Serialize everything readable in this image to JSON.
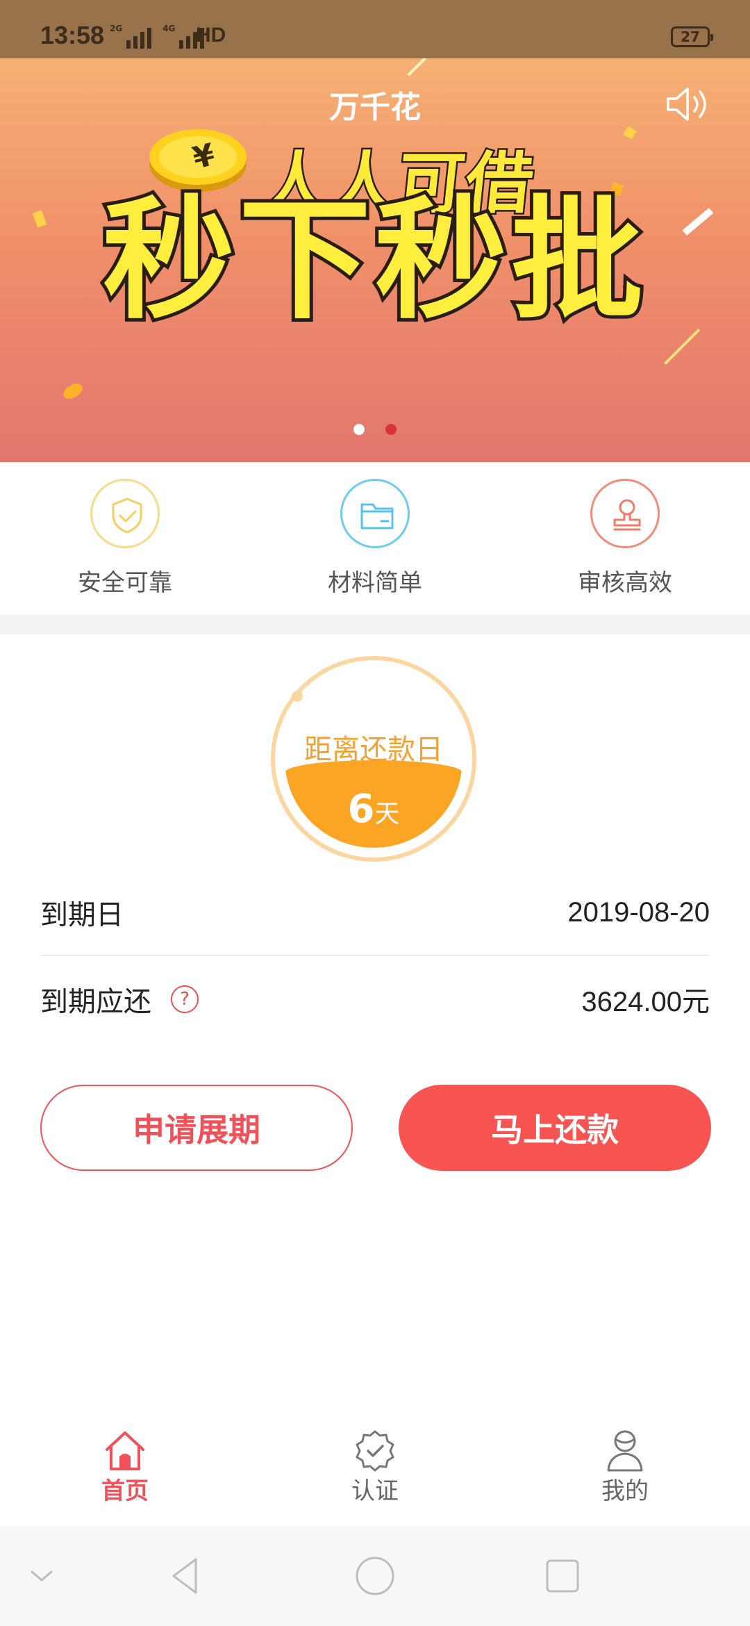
{
  "status_bar": {
    "time": "13:58",
    "network_1": "2G",
    "network_2": "4G",
    "hd_label": "HD",
    "battery": "27"
  },
  "banner": {
    "app_name": "万千花",
    "headline_1": "人人可借",
    "headline_2": "秒下秒批",
    "coin_symbol": "¥",
    "sound_icon": "speaker-icon",
    "page_count": 2,
    "active_page": 2
  },
  "features": [
    {
      "label": "安全可靠",
      "icon": "shield-check-icon",
      "color": "#f6dc86"
    },
    {
      "label": "材料简单",
      "icon": "folder-icon",
      "color": "#6ecbf0"
    },
    {
      "label": "审核高效",
      "icon": "stamp-icon",
      "color": "#f08c7a"
    }
  ],
  "countdown": {
    "label": "距离还款日",
    "days": "6",
    "unit": "天"
  },
  "loan": {
    "due_date_label": "到期日",
    "due_date": "2019-08-20",
    "due_amount_label": "到期应还",
    "due_amount": "3624.00元",
    "help_symbol": "?"
  },
  "actions": {
    "extend_label": "申请展期",
    "repay_label": "马上还款"
  },
  "bottom_nav": [
    {
      "label": "首页",
      "icon": "home-icon",
      "active": true
    },
    {
      "label": "认证",
      "icon": "verified-badge-icon",
      "active": false
    },
    {
      "label": "我的",
      "icon": "profile-icon",
      "active": false
    }
  ],
  "colors": {
    "accent": "#f75452",
    "countdown_fill": "#fca424",
    "countdown_text": "#f4a134"
  }
}
